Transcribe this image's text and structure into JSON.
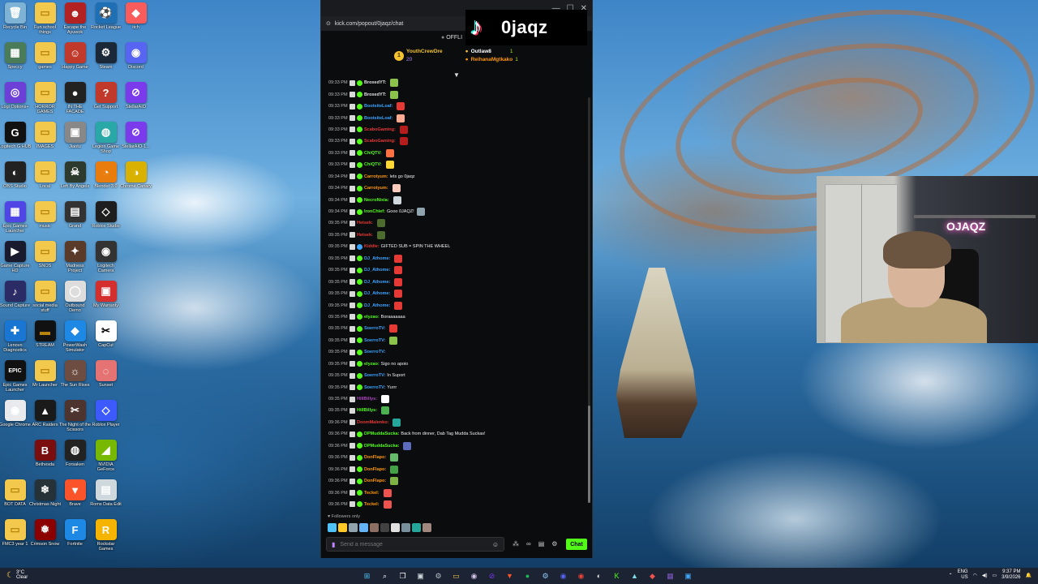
{
  "desktop": {
    "icons": [
      {
        "label": "Recycle Bin",
        "name": "recycle-bin-icon",
        "color": "#7fb3d5",
        "glyph": "🗑"
      },
      {
        "label": "Fun school things",
        "name": "folder-icon",
        "color": "#f2c94c",
        "glyph": "▭"
      },
      {
        "label": "Escape the Ayuwok",
        "name": "game-icon",
        "color": "#b22222",
        "glyph": "☻"
      },
      {
        "label": "Rocket League",
        "name": "rocket-league-icon",
        "color": "#1f6fb5",
        "glyph": "⚽"
      },
      {
        "label": "itch",
        "name": "itch-icon",
        "color": "#fa5c5c",
        "glyph": "◆"
      },
      {
        "label": "Speccy",
        "name": "speccy-icon",
        "color": "#4a7c59",
        "glyph": "▦"
      },
      {
        "label": "games",
        "name": "folder-icon",
        "color": "#f2c94c",
        "glyph": "▭"
      },
      {
        "label": "Happy Game",
        "name": "happy-game-icon",
        "color": "#c0392b",
        "glyph": "☺"
      },
      {
        "label": "Steam",
        "name": "steam-icon",
        "color": "#1b2838",
        "glyph": "⚙"
      },
      {
        "label": "Discord",
        "name": "discord-icon",
        "color": "#5865f2",
        "glyph": "◉"
      },
      {
        "label": "Logi Options+",
        "name": "logi-options-icon",
        "color": "#6c3fd6",
        "glyph": "◎"
      },
      {
        "label": "HORROR GAMES",
        "name": "folder-icon",
        "color": "#f2c94c",
        "glyph": "▭"
      },
      {
        "label": "IN THE FACADE",
        "name": "game-icon",
        "color": "#222222",
        "glyph": "●"
      },
      {
        "label": "Get Support",
        "name": "support-icon",
        "color": "#c0392b",
        "glyph": "?"
      },
      {
        "label": "StellarAIO",
        "name": "stellaraio-icon",
        "color": "#7c3aed",
        "glyph": "⊘"
      },
      {
        "label": "Logitech G HUB",
        "name": "ghub-icon",
        "color": "#111111",
        "glyph": "G"
      },
      {
        "label": "IMAGES",
        "name": "folder-icon",
        "color": "#f2c94c",
        "glyph": "▭"
      },
      {
        "label": "Jiaotu",
        "name": "app-icon",
        "color": "#888888",
        "glyph": "▣"
      },
      {
        "label": "Legion Game Shop",
        "name": "legion-shop-icon",
        "color": "#2aa7a7",
        "glyph": "◍"
      },
      {
        "label": "StellarAIO-1...",
        "name": "stellaraio-icon",
        "color": "#7c3aed",
        "glyph": "⊘"
      },
      {
        "label": "OBS Studio",
        "name": "obs-icon",
        "color": "#222222",
        "glyph": "◐"
      },
      {
        "label": "Local",
        "name": "folder-icon",
        "color": "#f2c94c",
        "glyph": "▭"
      },
      {
        "label": "Left By Angels",
        "name": "game-icon",
        "color": "#2d3a2e",
        "glyph": "☠"
      },
      {
        "label": "Blender 3.0",
        "name": "blender-icon",
        "color": "#e87d0d",
        "glyph": "◔"
      },
      {
        "label": "Chrome Canary",
        "name": "chrome-canary-icon",
        "color": "#d9b100",
        "glyph": "◑"
      },
      {
        "label": "Epic Games Launcher",
        "name": "app-icon",
        "color": "#4f46e5",
        "glyph": "▦"
      },
      {
        "label": "music",
        "name": "folder-icon",
        "color": "#f2c94c",
        "glyph": "▭"
      },
      {
        "label": "Grand",
        "name": "app-icon",
        "color": "#333333",
        "glyph": "▤"
      },
      {
        "label": "Roblox Studio",
        "name": "roblox-studio-icon",
        "color": "#1e1e1e",
        "glyph": "◇"
      },
      {
        "label": "",
        "name": "blank-icon",
        "color": "transparent",
        "glyph": ""
      },
      {
        "label": "Game Capture HD",
        "name": "capture-icon",
        "color": "#1a1a2e",
        "glyph": "▶"
      },
      {
        "label": "SNOS",
        "name": "folder-icon",
        "color": "#f2c94c",
        "glyph": "▭"
      },
      {
        "label": "Madness Project",
        "name": "game-icon",
        "color": "#5a3b2a",
        "glyph": "✦"
      },
      {
        "label": "Logitech Camera",
        "name": "camera-icon",
        "color": "#333333",
        "glyph": "◉"
      },
      {
        "label": "",
        "name": "blank-icon",
        "color": "transparent",
        "glyph": ""
      },
      {
        "label": "Sound Capture",
        "name": "sound-capture-icon",
        "color": "#2b2b66",
        "glyph": "♪"
      },
      {
        "label": "social media stuff",
        "name": "folder-icon",
        "color": "#f2c94c",
        "glyph": "▭"
      },
      {
        "label": "Outbound Demo",
        "name": "game-icon",
        "color": "#dddddd",
        "glyph": "◯"
      },
      {
        "label": "My Warranty",
        "name": "warranty-icon",
        "color": "#d32f2f",
        "glyph": "▣"
      },
      {
        "label": "",
        "name": "blank-icon",
        "color": "transparent",
        "glyph": ""
      },
      {
        "label": "Lenovo Diagnostics",
        "name": "diagnostics-icon",
        "color": "#1976d2",
        "glyph": "✚"
      },
      {
        "label": "STREAM",
        "name": "folder-icon",
        "color": "#111111",
        "glyph": "▬"
      },
      {
        "label": "PowerWash Simulator",
        "name": "game-icon",
        "color": "#1e88e5",
        "glyph": "◆"
      },
      {
        "label": "CapCut",
        "name": "capcut-icon",
        "color": "#ffffff",
        "glyph": "✂"
      },
      {
        "label": "",
        "name": "blank-icon",
        "color": "transparent",
        "glyph": ""
      },
      {
        "label": "Epic Games Launcher",
        "name": "epic-games-icon",
        "color": "#111111",
        "glyph": "EPIC"
      },
      {
        "label": "Mr Launcher",
        "name": "folder-icon",
        "color": "#f2c94c",
        "glyph": "▭"
      },
      {
        "label": "The Sun Rises",
        "name": "game-icon",
        "color": "#6d4c41",
        "glyph": "☼"
      },
      {
        "label": "Sunset",
        "name": "app-icon",
        "color": "#e57373",
        "glyph": "◌"
      },
      {
        "label": "",
        "name": "blank-icon",
        "color": "transparent",
        "glyph": ""
      },
      {
        "label": "Google Chrome",
        "name": "chrome-icon",
        "color": "#e8eaed",
        "glyph": "◉"
      },
      {
        "label": "ARC Raiders",
        "name": "game-icon",
        "color": "#1a1a1a",
        "glyph": "▲"
      },
      {
        "label": "The Night of the Scissors",
        "name": "game-icon",
        "color": "#4e342e",
        "glyph": "✂"
      },
      {
        "label": "Roblox Player",
        "name": "roblox-icon",
        "color": "#3d5afe",
        "glyph": "◇"
      },
      {
        "label": "",
        "name": "blank-icon",
        "color": "transparent",
        "glyph": ""
      },
      {
        "label": "",
        "name": "blank-icon",
        "color": "transparent",
        "glyph": ""
      },
      {
        "label": "Bethesda",
        "name": "bethesda-icon",
        "color": "#7a0d0d",
        "glyph": "B"
      },
      {
        "label": "Forsaken",
        "name": "game-icon",
        "color": "#222222",
        "glyph": "◍"
      },
      {
        "label": "NVIDIA GeForce",
        "name": "nvidia-icon",
        "color": "#76b900",
        "glyph": "◢"
      },
      {
        "label": "",
        "name": "blank-icon",
        "color": "transparent",
        "glyph": ""
      },
      {
        "label": "BOT DATA",
        "name": "folder-icon",
        "color": "#f2c94c",
        "glyph": "▭"
      },
      {
        "label": "Christmas Night",
        "name": "game-icon",
        "color": "#263238",
        "glyph": "❄"
      },
      {
        "label": "Brave",
        "name": "brave-icon",
        "color": "#fb542b",
        "glyph": "▼"
      },
      {
        "label": "Roms Data Edit",
        "name": "app-icon",
        "color": "#cfd8dc",
        "glyph": "▤"
      },
      {
        "label": "",
        "name": "blank-icon",
        "color": "transparent",
        "glyph": ""
      },
      {
        "label": "FMC3 year 1",
        "name": "folder-icon",
        "color": "#f2c94c",
        "glyph": "▭"
      },
      {
        "label": "Crimson Snow",
        "name": "game-icon",
        "color": "#8b0000",
        "glyph": "❅"
      },
      {
        "label": "Fortnite",
        "name": "fortnite-icon",
        "color": "#1e88e5",
        "glyph": "F"
      },
      {
        "label": "Rockstar Games",
        "name": "rockstar-icon",
        "color": "#f5b400",
        "glyph": "R"
      }
    ]
  },
  "chat": {
    "url": "kick.com/popout/0jaqz/chat",
    "offline_label": "OFFLI",
    "overlay_name": "0jaqz",
    "pinned": {
      "left_user": "YouthCrewDre",
      "left_count": "20",
      "right_users": [
        {
          "name": "Outlaw8",
          "count": "1"
        },
        {
          "name": "ReihanaMgtkako",
          "count": "1"
        }
      ]
    },
    "messages": [
      {
        "time": "09:33 PM",
        "user": "BroxedYT:",
        "text": "",
        "color": "#e0e0e0",
        "badge": "green",
        "emote": "#8bc34a"
      },
      {
        "time": "09:33 PM",
        "user": "BroxedYT:",
        "text": "",
        "color": "#e0e0e0",
        "badge": "green",
        "emote": "#8bc34a"
      },
      {
        "time": "09:33 PM",
        "user": "BootsiteLoaf:",
        "text": "",
        "color": "#3ba4ff",
        "badge": "green",
        "emote": "#e53935"
      },
      {
        "time": "09:33 PM",
        "user": "BootsiteLoaf:",
        "text": "",
        "color": "#3ba4ff",
        "badge": "green",
        "emote": "#ffab91"
      },
      {
        "time": "09:33 PM",
        "user": "ScaboGaming:",
        "text": "",
        "color": "#e53935",
        "badge": "green",
        "emote": "#b71c1c"
      },
      {
        "time": "09:33 PM",
        "user": "ScaboGaming:",
        "text": "",
        "color": "#e53935",
        "badge": "green",
        "emote": "#b71c1c"
      },
      {
        "time": "09:33 PM",
        "user": "ChiQTV:",
        "text": "",
        "color": "#53fc18",
        "badge": "green",
        "emote": "#ff7043"
      },
      {
        "time": "09:33 PM",
        "user": "ChiQTV:",
        "text": "",
        "color": "#53fc18",
        "badge": "green",
        "emote": "#fdd835"
      },
      {
        "time": "09:34 PM",
        "user": "Carrotyum:",
        "text": "lets go 0jaqz",
        "color": "#ff9800",
        "badge": "green",
        "emote": ""
      },
      {
        "time": "09:34 PM",
        "user": "Carrotyum:",
        "text": "",
        "color": "#ff9800",
        "badge": "green",
        "emote": "#ffccbc"
      },
      {
        "time": "09:34 PM",
        "user": "NecroNixia:",
        "text": "",
        "color": "#53fc18",
        "badge": "green",
        "emote": "#cfd8dc"
      },
      {
        "time": "09:34 PM",
        "user": "IronChief:",
        "text": "Gooo 0JAQZ!",
        "color": "#53fc18",
        "badge": "green",
        "emote": "#90a4ae"
      },
      {
        "time": "09:35 PM",
        "user": "Hetsek:",
        "text": "",
        "color": "#e53935",
        "badge": "",
        "emote": "#4e6b2e"
      },
      {
        "time": "09:35 PM",
        "user": "Hetsek:",
        "text": "",
        "color": "#e53935",
        "badge": "",
        "emote": "#4e6b2e"
      },
      {
        "time": "09:35 PM",
        "user": "Kiddie:",
        "text": "GIFTED SUB = SPIN THE WHEEL",
        "color": "#e53935",
        "badge": "blue",
        "emote": ""
      },
      {
        "time": "09:35 PM",
        "user": "DJ_Athome:",
        "text": "",
        "color": "#3ba4ff",
        "badge": "green",
        "emote": "#e53935"
      },
      {
        "time": "09:35 PM",
        "user": "DJ_Athome:",
        "text": "",
        "color": "#3ba4ff",
        "badge": "green",
        "emote": "#e53935"
      },
      {
        "time": "09:35 PM",
        "user": "DJ_Athome:",
        "text": "",
        "color": "#3ba4ff",
        "badge": "green",
        "emote": "#e53935"
      },
      {
        "time": "09:35 PM",
        "user": "DJ_Athome:",
        "text": "",
        "color": "#3ba4ff",
        "badge": "green",
        "emote": "#e53935"
      },
      {
        "time": "09:35 PM",
        "user": "DJ_Athome:",
        "text": "",
        "color": "#3ba4ff",
        "badge": "green",
        "emote": "#e53935"
      },
      {
        "time": "09:35 PM",
        "user": "elyzao:",
        "text": "Boraaaaaaa",
        "color": "#53fc18",
        "badge": "green",
        "emote": ""
      },
      {
        "time": "09:35 PM",
        "user": "SoerroTV:",
        "text": "",
        "color": "#3ba4ff",
        "badge": "green",
        "emote": "#e53935"
      },
      {
        "time": "09:35 PM",
        "user": "SoerroTV:",
        "text": "",
        "color": "#3ba4ff",
        "badge": "green",
        "emote": "#8bc34a"
      },
      {
        "time": "09:35 PM",
        "user": "SoerroTV:",
        "text": "",
        "color": "#3ba4ff",
        "badge": "green",
        "emote": ""
      },
      {
        "time": "09:35 PM",
        "user": "elyzao:",
        "text": "Sigo no apoio",
        "color": "#53fc18",
        "badge": "green",
        "emote": ""
      },
      {
        "time": "09:35 PM",
        "user": "SoerroTV:",
        "text": "In Suport",
        "color": "#3ba4ff",
        "badge": "green",
        "emote": ""
      },
      {
        "time": "09:35 PM",
        "user": "SoerroTV:",
        "text": "Yurrr",
        "color": "#3ba4ff",
        "badge": "green",
        "emote": ""
      },
      {
        "time": "09:35 PM",
        "user": "HillBillys:",
        "text": "",
        "color": "#ab47bc",
        "badge": "",
        "emote": "#ffffff"
      },
      {
        "time": "09:35 PM",
        "user": "HillBillys:",
        "text": "",
        "color": "#53fc18",
        "badge": "",
        "emote": "#4caf50"
      },
      {
        "time": "09:36 PM",
        "user": "DoomMalenko:",
        "text": "",
        "color": "#e53935",
        "badge": "",
        "emote": "#26a69a"
      },
      {
        "time": "09:36 PM",
        "user": "DPMuddaSucka:",
        "text": "Back from dinner, Dab Tag Mudda Suckas!",
        "color": "#53fc18",
        "badge": "green",
        "emote": ""
      },
      {
        "time": "09:36 PM",
        "user": "DPMuddaSucka:",
        "text": "",
        "color": "#53fc18",
        "badge": "green",
        "emote": "#5c6bc0"
      },
      {
        "time": "09:36 PM",
        "user": "DonFlapo:",
        "text": "",
        "color": "#ff9800",
        "badge": "green",
        "emote": "#66bb6a"
      },
      {
        "time": "09:36 PM",
        "user": "DonFlapo:",
        "text": "",
        "color": "#ff9800",
        "badge": "green",
        "emote": "#43a047"
      },
      {
        "time": "09:36 PM",
        "user": "DonFlapo:",
        "text": "",
        "color": "#ff9800",
        "badge": "green",
        "emote": "#7cb342"
      },
      {
        "time": "09:36 PM",
        "user": "Teckel:",
        "text": "",
        "color": "#ff9800",
        "badge": "green",
        "emote": "#ef5350"
      },
      {
        "time": "09:36 PM",
        "user": "Teckel:",
        "text": "",
        "color": "#ff9800",
        "badge": "green",
        "emote": "#ef5350"
      }
    ],
    "followers_only": "Followers only",
    "composer_placeholder": "Send a message",
    "send_label": "Chat",
    "emote_strip": [
      "#4fc3f7",
      "#ffca28",
      "#90a4ae",
      "#64b5f6",
      "#8d6e63",
      "#424242",
      "#e0e0e0",
      "#78909c",
      "#26a69a",
      "#a1887f"
    ]
  },
  "webcam": {
    "neon_sign": "OJAQZ"
  },
  "taskbar": {
    "weather_temp": "3°C",
    "weather_desc": "Clear",
    "lang_1": "ENG",
    "lang_2": "US",
    "time": "9:37 PM",
    "date": "3/9/2026",
    "apps": [
      {
        "name": "start-icon",
        "glyph": "⊞",
        "color": "#4fc3f7"
      },
      {
        "name": "search-icon",
        "glyph": "⌕",
        "color": "#ffffff"
      },
      {
        "name": "task-view-icon",
        "glyph": "❐",
        "color": "#ffffff"
      },
      {
        "name": "widgets-icon",
        "glyph": "▣",
        "color": "#cfd8dc"
      },
      {
        "name": "settings-icon",
        "glyph": "⚙",
        "color": "#b0bec5"
      },
      {
        "name": "file-explorer-icon",
        "glyph": "▭",
        "color": "#f2c94c"
      },
      {
        "name": "obs-icon",
        "glyph": "◉",
        "color": "#d1c4e9"
      },
      {
        "name": "stellaraio-icon",
        "glyph": "⊘",
        "color": "#7c3aed"
      },
      {
        "name": "brave-icon",
        "glyph": "▼",
        "color": "#fb542b"
      },
      {
        "name": "spotify-icon",
        "glyph": "●",
        "color": "#1db954"
      },
      {
        "name": "steam-icon",
        "glyph": "⚙",
        "color": "#90caf9"
      },
      {
        "name": "discord-icon",
        "glyph": "◉",
        "color": "#5865f2"
      },
      {
        "name": "chrome-icon",
        "glyph": "◉",
        "color": "#ea4335"
      },
      {
        "name": "obs-studio-icon",
        "glyph": "◐",
        "color": "#e0e0e0"
      },
      {
        "name": "kick-icon",
        "glyph": "K",
        "color": "#53fc18"
      },
      {
        "name": "streamlabs-icon",
        "glyph": "▲",
        "color": "#80deea"
      },
      {
        "name": "app-icon",
        "glyph": "◆",
        "color": "#ef5350"
      },
      {
        "name": "app-icon",
        "glyph": "▦",
        "color": "#7e57c2"
      },
      {
        "name": "app-icon",
        "glyph": "▣",
        "color": "#42a5f5"
      }
    ]
  }
}
